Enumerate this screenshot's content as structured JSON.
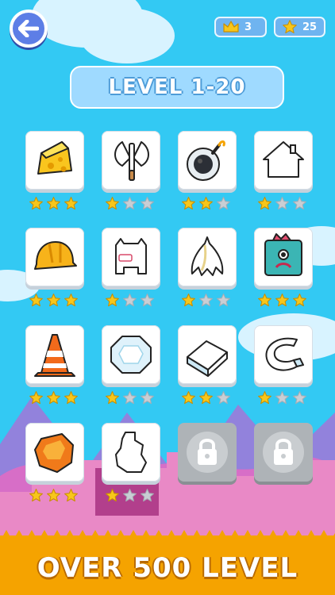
{
  "header": {
    "crown_count": "3",
    "star_count": "25",
    "level_title": "LEVEL 1-20"
  },
  "footer": {
    "tagline": "OVER 500 LEVEL"
  },
  "colors": {
    "sky": "#33c9f3",
    "star_on": "#f7c61b",
    "star_off": "#c9ced4",
    "band": "#f5a300"
  },
  "levels": [
    {
      "item": "cheese-icon",
      "stars": 3,
      "locked": false
    },
    {
      "item": "axe-icon",
      "stars": 1,
      "locked": false
    },
    {
      "item": "bomb-icon",
      "stars": 2,
      "locked": false
    },
    {
      "item": "house-icon",
      "stars": 1,
      "locked": false
    },
    {
      "item": "hard-hat-icon",
      "stars": 3,
      "locked": false
    },
    {
      "item": "monster-icon",
      "stars": 1,
      "locked": false
    },
    {
      "item": "banana-peel-icon",
      "stars": 1,
      "locked": false
    },
    {
      "item": "box-monster-icon",
      "stars": 3,
      "locked": false
    },
    {
      "item": "traffic-cone-icon",
      "stars": 3,
      "locked": false
    },
    {
      "item": "gem-icon",
      "stars": 1,
      "locked": false
    },
    {
      "item": "book-icon",
      "stars": 2,
      "locked": false
    },
    {
      "item": "magnet-icon",
      "stars": 1,
      "locked": false
    },
    {
      "item": "rock-icon",
      "stars": 3,
      "locked": false
    },
    {
      "item": "map-island-icon",
      "stars": 1,
      "locked": false
    },
    {
      "item": "lock-icon",
      "stars": 0,
      "locked": true
    },
    {
      "item": "lock-icon",
      "stars": 0,
      "locked": true
    }
  ]
}
